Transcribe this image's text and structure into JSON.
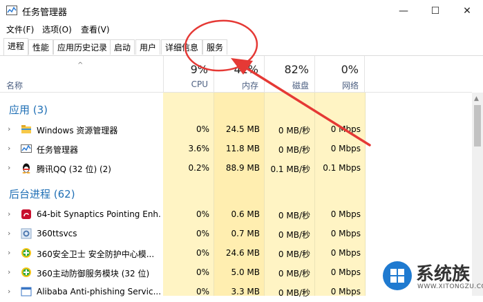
{
  "window": {
    "title": "任务管理器",
    "minimize_glyph": "—",
    "maximize_glyph": "☐",
    "close_glyph": "✕"
  },
  "menu": [
    "文件(F)",
    "选项(O)",
    "查看(V)"
  ],
  "tabs": [
    "进程",
    "性能",
    "应用历史记录",
    "启动",
    "用户",
    "详细信息",
    "服务"
  ],
  "header": {
    "name_label": "名称",
    "sort_caret": "^",
    "columns": [
      {
        "pct": "9%",
        "name": "CPU"
      },
      {
        "pct": "41%",
        "name": "内存"
      },
      {
        "pct": "82%",
        "name": "磁盘"
      },
      {
        "pct": "0%",
        "name": "网络"
      }
    ]
  },
  "sections": {
    "apps": "应用 (3)",
    "background": "后台进程 (62)"
  },
  "apps": [
    {
      "name": "Windows 资源管理器",
      "icon": "folder-icon",
      "cpu": "0%",
      "mem": "24.5 MB",
      "disk": "0 MB/秒",
      "net": "0 Mbps"
    },
    {
      "name": "任务管理器",
      "icon": "task-manager-icon",
      "cpu": "3.6%",
      "mem": "11.8 MB",
      "disk": "0 MB/秒",
      "net": "0 Mbps"
    },
    {
      "name": "腾讯QQ (32 位) (2)",
      "icon": "qq-penguin-icon",
      "cpu": "0.2%",
      "mem": "88.9 MB",
      "disk": "0.1 MB/秒",
      "net": "0.1 Mbps"
    }
  ],
  "background": [
    {
      "name": "64-bit Synaptics Pointing Enh...",
      "icon": "synaptics-icon",
      "cpu": "0%",
      "mem": "0.6 MB",
      "disk": "0 MB/秒",
      "net": "0 Mbps"
    },
    {
      "name": "360ttsvcs",
      "icon": "service-gear-icon",
      "cpu": "0%",
      "mem": "0.7 MB",
      "disk": "0 MB/秒",
      "net": "0 Mbps"
    },
    {
      "name": "360安全卫士 安全防护中心模...",
      "icon": "360-shield-icon",
      "cpu": "0%",
      "mem": "24.6 MB",
      "disk": "0 MB/秒",
      "net": "0 Mbps"
    },
    {
      "name": "360主动防御服务模块 (32 位)",
      "icon": "360-shield-icon",
      "cpu": "0%",
      "mem": "5.0 MB",
      "disk": "0 MB/秒",
      "net": "0 Mbps"
    },
    {
      "name": "Alibaba Anti-phishing Servic...",
      "icon": "window-icon",
      "cpu": "0%",
      "mem": "3.3 MB",
      "disk": "0 MB/秒",
      "net": "0 Mbps"
    }
  ],
  "watermark": {
    "text": "系统族",
    "sub": "WWW.XITONGZU.COM"
  },
  "colors": {
    "accent": "#1f6fb5",
    "annotation": "#e53935",
    "heat_band": "#fff4c4"
  }
}
